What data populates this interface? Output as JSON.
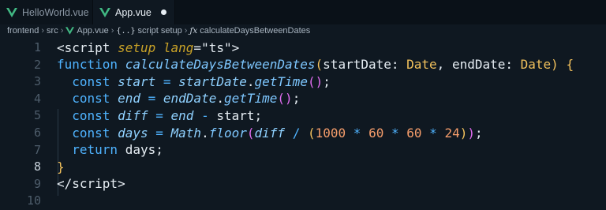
{
  "tabs": [
    {
      "label": "HelloWorld.vue",
      "active": false
    },
    {
      "label": "App.vue",
      "active": true,
      "modified": true
    }
  ],
  "breadcrumb": {
    "parts": [
      "frontend",
      "src",
      "App.vue",
      "script setup",
      "calculateDaysBetweenDates"
    ]
  },
  "editor": {
    "line_numbers": [
      "1",
      "2",
      "3",
      "4",
      "5",
      "6",
      "7",
      "8",
      "9",
      "10"
    ],
    "current_line": "8",
    "lines": [
      {
        "tokens": [
          [
            "plain",
            "<"
          ],
          [
            "plain",
            "script"
          ],
          [
            "plain",
            " "
          ],
          [
            "attr",
            "setup"
          ],
          [
            "plain",
            " "
          ],
          [
            "attr",
            "lang"
          ],
          [
            "plain",
            "="
          ],
          [
            "str",
            "\"ts\""
          ],
          [
            "plain",
            ">"
          ]
        ]
      },
      {
        "tokens": [
          [
            "kw",
            "function"
          ],
          [
            "plain",
            " "
          ],
          [
            "fn",
            "calculateDaysBetweenDates"
          ],
          [
            "paren-y",
            "("
          ],
          [
            "plain",
            "startDate: "
          ],
          [
            "type",
            "Date"
          ],
          [
            "plain",
            ", endDate: "
          ],
          [
            "type",
            "Date"
          ],
          [
            "paren-y",
            ")"
          ],
          [
            "plain",
            " "
          ],
          [
            "paren-y",
            "{"
          ]
        ]
      },
      {
        "tokens": [
          [
            "plain",
            "  "
          ],
          [
            "kw",
            "const"
          ],
          [
            "plain",
            " "
          ],
          [
            "var",
            "start"
          ],
          [
            "plain",
            " "
          ],
          [
            "op",
            "="
          ],
          [
            "plain",
            " "
          ],
          [
            "obj",
            "startDate"
          ],
          [
            "plain",
            "."
          ],
          [
            "fn",
            "getTime"
          ],
          [
            "paren-p",
            "()"
          ],
          [
            "plain",
            ";"
          ]
        ]
      },
      {
        "tokens": [
          [
            "plain",
            "  "
          ],
          [
            "kw",
            "const"
          ],
          [
            "plain",
            " "
          ],
          [
            "var",
            "end"
          ],
          [
            "plain",
            " "
          ],
          [
            "op",
            "="
          ],
          [
            "plain",
            " "
          ],
          [
            "obj",
            "endDate"
          ],
          [
            "plain",
            "."
          ],
          [
            "fn",
            "getTime"
          ],
          [
            "paren-p",
            "()"
          ],
          [
            "plain",
            ";"
          ]
        ]
      },
      {
        "tokens": [
          [
            "plain",
            "  "
          ],
          [
            "kw",
            "const"
          ],
          [
            "plain",
            " "
          ],
          [
            "var",
            "diff"
          ],
          [
            "plain",
            " "
          ],
          [
            "op",
            "="
          ],
          [
            "plain",
            " "
          ],
          [
            "obj",
            "end"
          ],
          [
            "plain",
            " "
          ],
          [
            "op",
            "-"
          ],
          [
            "plain",
            " start;"
          ]
        ]
      },
      {
        "tokens": [
          [
            "plain",
            "  "
          ],
          [
            "kw",
            "const"
          ],
          [
            "plain",
            " "
          ],
          [
            "var",
            "days"
          ],
          [
            "plain",
            " "
          ],
          [
            "op",
            "="
          ],
          [
            "plain",
            " "
          ],
          [
            "obj",
            "Math"
          ],
          [
            "plain",
            "."
          ],
          [
            "fn",
            "floor"
          ],
          [
            "paren-p",
            "("
          ],
          [
            "obj",
            "diff"
          ],
          [
            "plain",
            " "
          ],
          [
            "op",
            "/"
          ],
          [
            "plain",
            " "
          ],
          [
            "paren-y",
            "("
          ],
          [
            "num",
            "1000"
          ],
          [
            "plain",
            " "
          ],
          [
            "op",
            "*"
          ],
          [
            "plain",
            " "
          ],
          [
            "num",
            "60"
          ],
          [
            "plain",
            " "
          ],
          [
            "op",
            "*"
          ],
          [
            "plain",
            " "
          ],
          [
            "num",
            "60"
          ],
          [
            "plain",
            " "
          ],
          [
            "op",
            "*"
          ],
          [
            "plain",
            " "
          ],
          [
            "num",
            "24"
          ],
          [
            "paren-y",
            ")"
          ],
          [
            "paren-p",
            ")"
          ],
          [
            "plain",
            ";"
          ]
        ]
      },
      {
        "tokens": [
          [
            "plain",
            "  "
          ],
          [
            "kw",
            "return"
          ],
          [
            "plain",
            " days;"
          ]
        ]
      },
      {
        "tokens": [
          [
            "paren-y",
            "}"
          ]
        ]
      },
      {
        "tokens": [
          [
            "plain",
            "</"
          ],
          [
            "plain",
            "script"
          ],
          [
            "plain",
            ">"
          ]
        ]
      },
      {
        "tokens": []
      }
    ]
  },
  "colors": {
    "background": "#0f1821",
    "accent": "#4fb3ff",
    "vue_green": "#41b883"
  }
}
